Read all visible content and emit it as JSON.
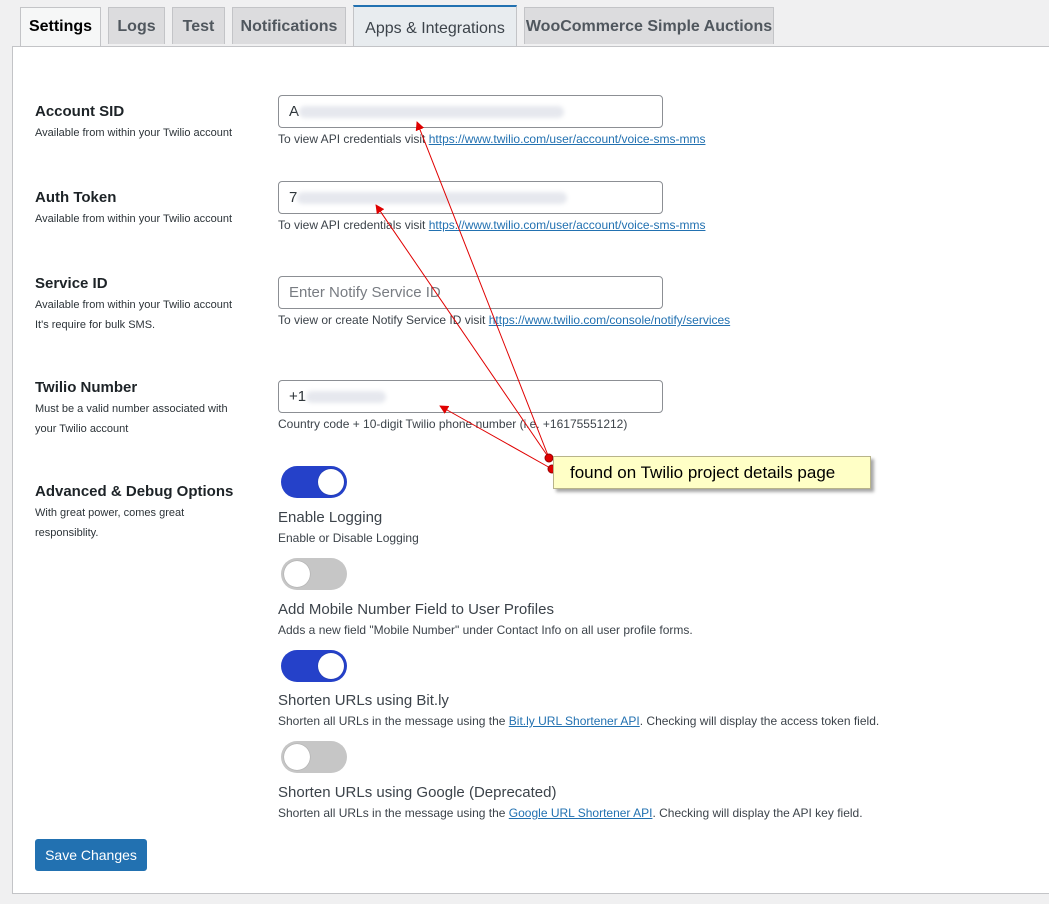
{
  "tabs": [
    {
      "label": "Settings"
    },
    {
      "label": "Logs"
    },
    {
      "label": "Test"
    },
    {
      "label": "Notifications"
    },
    {
      "label": "Apps & Integrations"
    },
    {
      "label": "WooCommerce Simple Auctions"
    }
  ],
  "account_sid": {
    "label": "Account SID",
    "desc": "Available from within your Twilio account",
    "value_prefix": "A",
    "hint_text": "To view API credentials visit ",
    "hint_link": "https://www.twilio.com/user/account/voice-sms-mms"
  },
  "auth_token": {
    "label": "Auth Token",
    "desc": "Available from within your Twilio account",
    "value_prefix": "7",
    "hint_text": "To view API credentials visit ",
    "hint_link": "https://www.twilio.com/user/account/voice-sms-mms"
  },
  "service_id": {
    "label": "Service ID",
    "desc_line1": "Available from within your Twilio account",
    "desc_line2": "It's require for bulk SMS.",
    "placeholder": "Enter Notify Service ID",
    "hint_text": "To view or create Notify Service ID visit ",
    "hint_link": "https://www.twilio.com/console/notify/services"
  },
  "twilio_number": {
    "label": "Twilio Number",
    "desc_line1": "Must be a valid number associated with",
    "desc_line2": "your Twilio account",
    "value_prefix": "+1",
    "hint": "Country code + 10-digit Twilio phone number (i.e. +16175551212)"
  },
  "advanced": {
    "label": "Advanced & Debug Options",
    "desc_line1": "With great power, comes great",
    "desc_line2": "responsiblity.",
    "options": [
      {
        "title": "Enable Logging",
        "desc": "Enable or Disable Logging",
        "enabled": true
      },
      {
        "title": "Add Mobile Number Field to User Profiles",
        "desc": "Adds a new field \"Mobile Number\" under Contact Info on all user profile forms.",
        "enabled": false
      },
      {
        "title": "Shorten URLs using Bit.ly",
        "desc_before": "Shorten all URLs in the message using the ",
        "link": "Bit.ly URL Shortener API",
        "desc_after": ". Checking will display the access token field.",
        "enabled": true
      },
      {
        "title": "Shorten URLs using Google (Deprecated)",
        "desc_before": "Shorten all URLs in the message using the ",
        "link": "Google URL Shortener API",
        "desc_after": ". Checking will display the API key field.",
        "enabled": false
      }
    ]
  },
  "save_label": "Save Changes",
  "callout": {
    "text": "found on Twilio project details page"
  },
  "colors": {
    "accent": "#2271b1",
    "toggle_on": "#2541c9",
    "arrow": "#e00000",
    "callout_bg": "#ffffc6"
  }
}
